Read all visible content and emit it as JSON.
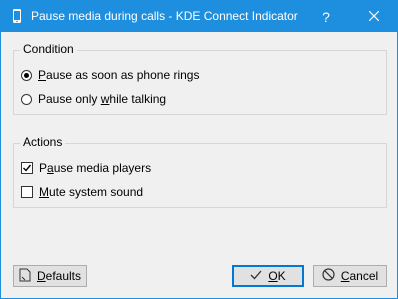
{
  "window": {
    "title": "Pause media during calls - KDE Connect Indicator",
    "help_label": "?",
    "close_label": "✕"
  },
  "condition": {
    "title": "Condition",
    "options": [
      {
        "label_pre": "",
        "label_ul": "P",
        "label_post": "ause as soon as phone rings",
        "selected": true
      },
      {
        "label_pre": "Pause only ",
        "label_ul": "w",
        "label_post": "hile talking",
        "selected": false
      }
    ]
  },
  "actions": {
    "title": "Actions",
    "items": [
      {
        "label_pre": "P",
        "label_ul": "a",
        "label_post": "use media players",
        "checked": true
      },
      {
        "label_pre": "",
        "label_ul": "M",
        "label_post": "ute system sound",
        "checked": false
      }
    ]
  },
  "buttons": {
    "defaults_ul": "D",
    "defaults_post": "efaults",
    "ok_ul": "O",
    "ok_post": "K",
    "cancel_ul": "C",
    "cancel_post": "ancel"
  },
  "colors": {
    "titlebar": "#1e8fde",
    "accent": "#0078d7"
  }
}
